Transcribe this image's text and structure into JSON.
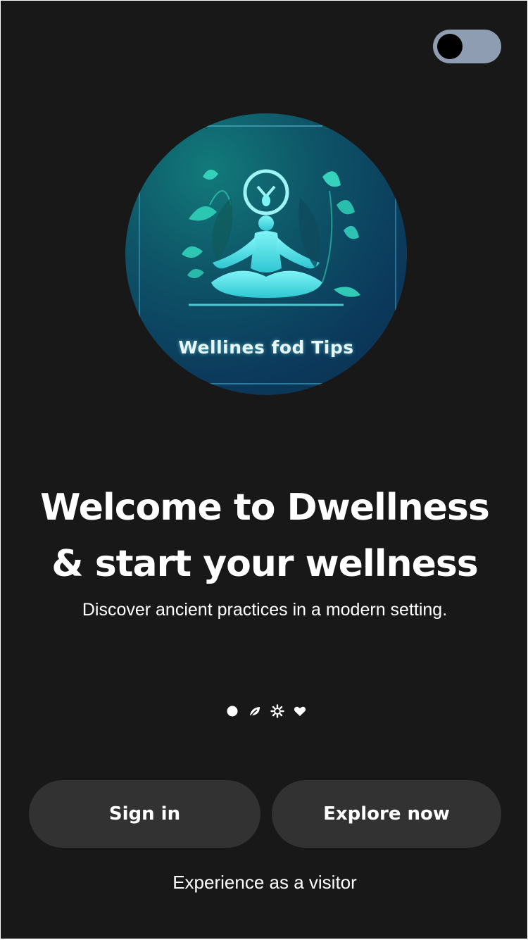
{
  "theme": {
    "background": "#181818",
    "toggle_track": "#8f9db3",
    "toggle_knob": "#000000",
    "button_bg": "#323232",
    "text": "#ffffff",
    "hero_accent": "#3fe0e4"
  },
  "theme_toggle": {
    "icon": "dark-mode-toggle",
    "state": "off"
  },
  "hero": {
    "caption": "Wellines fod Tips",
    "icon": "meditation-figure-illustration"
  },
  "headline": {
    "line1": "Welcome to Dwellness",
    "line2": "& start your wellness"
  },
  "subtitle": "Discover ancient practices in a modern setting.",
  "pager": {
    "items": [
      {
        "icon": "dot-icon",
        "active": true
      },
      {
        "icon": "leaf-icon",
        "active": false
      },
      {
        "icon": "sun-icon",
        "active": false
      },
      {
        "icon": "heart-icon",
        "active": false
      }
    ]
  },
  "actions": {
    "sign_in_label": "Sign in",
    "explore_label": "Explore now",
    "visitor_label": "Experience as a visitor"
  }
}
